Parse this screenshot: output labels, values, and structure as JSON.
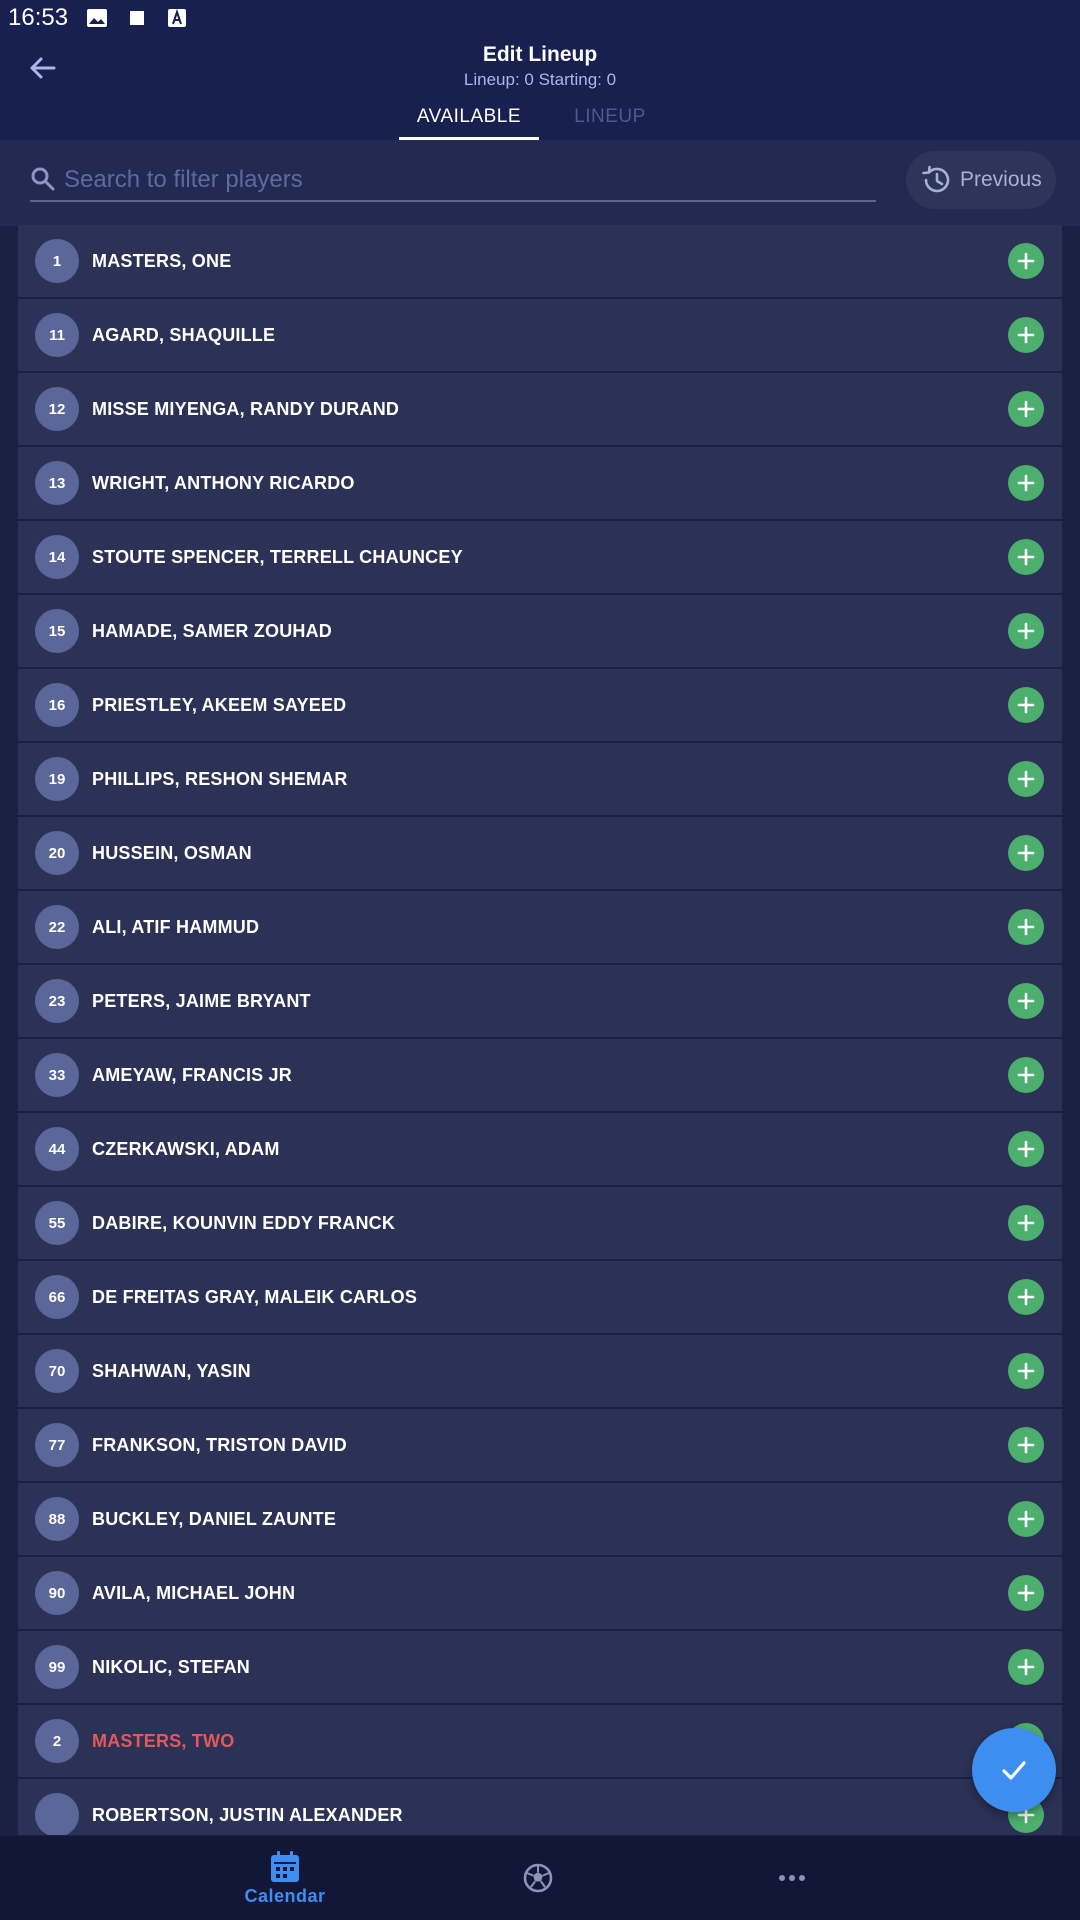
{
  "status_bar": {
    "time": "16:53"
  },
  "header": {
    "title": "Edit Lineup",
    "subtitle": "Lineup: 0 Starting: 0",
    "tabs": [
      {
        "label": "AVAILABLE",
        "active": true
      },
      {
        "label": "LINEUP",
        "active": false
      }
    ]
  },
  "search": {
    "placeholder": "Search to filter players",
    "value": "",
    "previous_label": "Previous"
  },
  "players": [
    {
      "number": "1",
      "name": "MASTERS, ONE"
    },
    {
      "number": "11",
      "name": "AGARD, SHAQUILLE"
    },
    {
      "number": "12",
      "name": "MISSE MIYENGA, RANDY DURAND"
    },
    {
      "number": "13",
      "name": "WRIGHT, ANTHONY RICARDO"
    },
    {
      "number": "14",
      "name": "STOUTE SPENCER, TERRELL CHAUNCEY"
    },
    {
      "number": "15",
      "name": "HAMADE, SAMER ZOUHAD"
    },
    {
      "number": "16",
      "name": "PRIESTLEY, AKEEM SAYEED"
    },
    {
      "number": "19",
      "name": "PHILLIPS, RESHON SHEMAR"
    },
    {
      "number": "20",
      "name": "HUSSEIN, OSMAN"
    },
    {
      "number": "22",
      "name": "ALI, ATIF HAMMUD"
    },
    {
      "number": "23",
      "name": "PETERS, JAIME BRYANT"
    },
    {
      "number": "33",
      "name": "AMEYAW, FRANCIS JR"
    },
    {
      "number": "44",
      "name": "CZERKAWSKI, ADAM"
    },
    {
      "number": "55",
      "name": "DABIRE, KOUNVIN EDDY FRANCK"
    },
    {
      "number": "66",
      "name": "DE FREITAS GRAY, MALEIK CARLOS"
    },
    {
      "number": "70",
      "name": "SHAHWAN, YASIN"
    },
    {
      "number": "77",
      "name": "FRANKSON, TRISTON DAVID"
    },
    {
      "number": "88",
      "name": "BUCKLEY, DANIEL ZAUNTE"
    },
    {
      "number": "90",
      "name": "AVILA, MICHAEL JOHN"
    },
    {
      "number": "99",
      "name": "NIKOLIC, STEFAN"
    },
    {
      "number": "2",
      "name": "MASTERS, TWO",
      "highlight": true
    },
    {
      "number": "",
      "name": "ROBERTSON, JUSTIN ALEXANDER"
    }
  ],
  "bottom_nav": {
    "items": [
      {
        "icon": "calendar-icon",
        "label": "Calendar",
        "active": true
      },
      {
        "icon": "soccer-ball-icon",
        "label": "",
        "active": false
      },
      {
        "icon": "more-icon",
        "label": "",
        "active": false
      }
    ]
  },
  "colors": {
    "background": "#1b2142",
    "header": "#17204e",
    "row": "#2b3256",
    "add_button": "#4caf6e",
    "fab": "#3d8ef0",
    "accent": "#3d8ef0",
    "highlight_name": "#e4585b"
  }
}
